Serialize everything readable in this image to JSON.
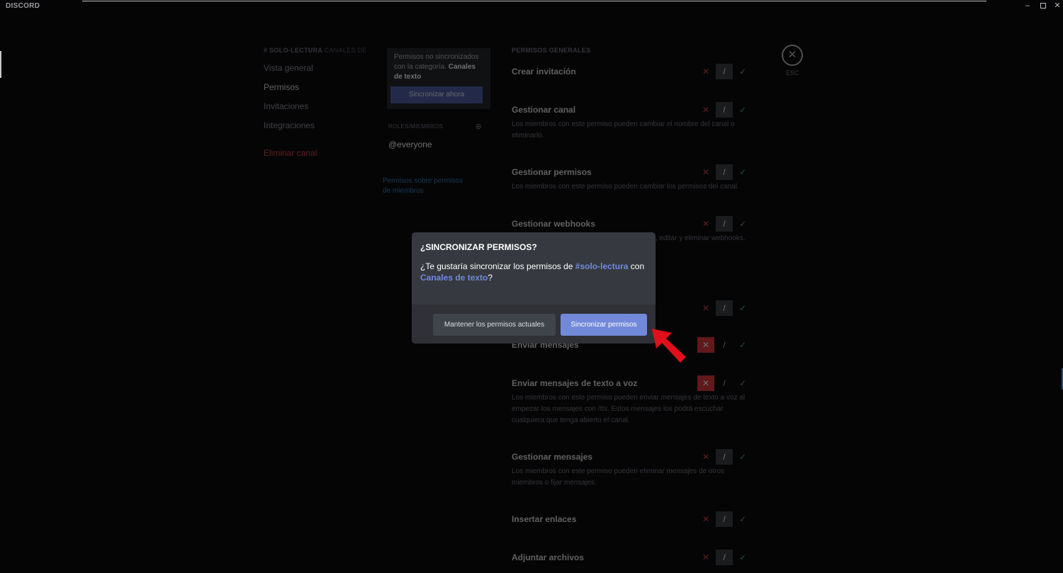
{
  "app": {
    "name": "DISCORD"
  },
  "sidebar": {
    "header": "# SOLO-LECTURA",
    "header_sub": "CANALES DE TEXTO",
    "items": [
      {
        "label": "Vista general"
      },
      {
        "label": "Permisos"
      },
      {
        "label": "Invitaciones"
      },
      {
        "label": "Integraciones"
      }
    ],
    "delete_label": "Eliminar canal"
  },
  "middle": {
    "notice_prefix": "Permisos no sincronizados con la categoría.",
    "notice_category": "Canales de texto",
    "sync_now_label": "Sincronizar ahora",
    "roles_header": "ROLES/MIEMBROS",
    "role": "@everyone",
    "link": "Permisos sobre permisos de miembros"
  },
  "perms": {
    "header": "PERMISOS GENERALES",
    "items": [
      {
        "title": "Crear invitación",
        "desc": ""
      },
      {
        "title": "Gestionar canal",
        "desc": "Los miembros con este permiso pueden cambiar el nombre del canal o eliminarlo."
      },
      {
        "title": "Gestionar permisos",
        "desc": "Los miembros con este permiso pueden cambiar los permisos del canal."
      },
      {
        "title": "Gestionar webhooks",
        "desc": "Los miembros con este permiso pueden crear, editar y eliminar webhooks."
      },
      {
        "title": "Enviar mensajes",
        "desc": ""
      },
      {
        "title": "Enviar mensajes de texto a voz",
        "desc": "Los miembros con este permiso pueden enviar mensajes de texto a voz al empezar los mensajes con /tts. Estos mensajes los podrá escuchar cualquiera que tenga abierto el canal."
      },
      {
        "title": "Gestionar mensajes",
        "desc": "Los miembros con este permiso pueden eliminar mensajes de otros miembros o fijar mensajes."
      },
      {
        "title": "Insertar enlaces",
        "desc": ""
      },
      {
        "title": "Adjuntar archivos",
        "desc": ""
      }
    ]
  },
  "close": {
    "esc_label": "ESC"
  },
  "modal": {
    "title": "¿SINCRONIZAR PERMISOS?",
    "text_prefix": "¿Te gustaría sincronizar los permisos de ",
    "channel": "#solo-lectura",
    "text_middle": " con ",
    "category": "Canales de texto",
    "text_suffix": "?",
    "keep_label": "Mantener los permisos actuales",
    "sync_label": "Sincronizar permisos"
  },
  "colors": {
    "accent": "#7289da",
    "deny": "#e03535",
    "allow": "#43b581",
    "annotation_arrow": "#e0101a"
  }
}
